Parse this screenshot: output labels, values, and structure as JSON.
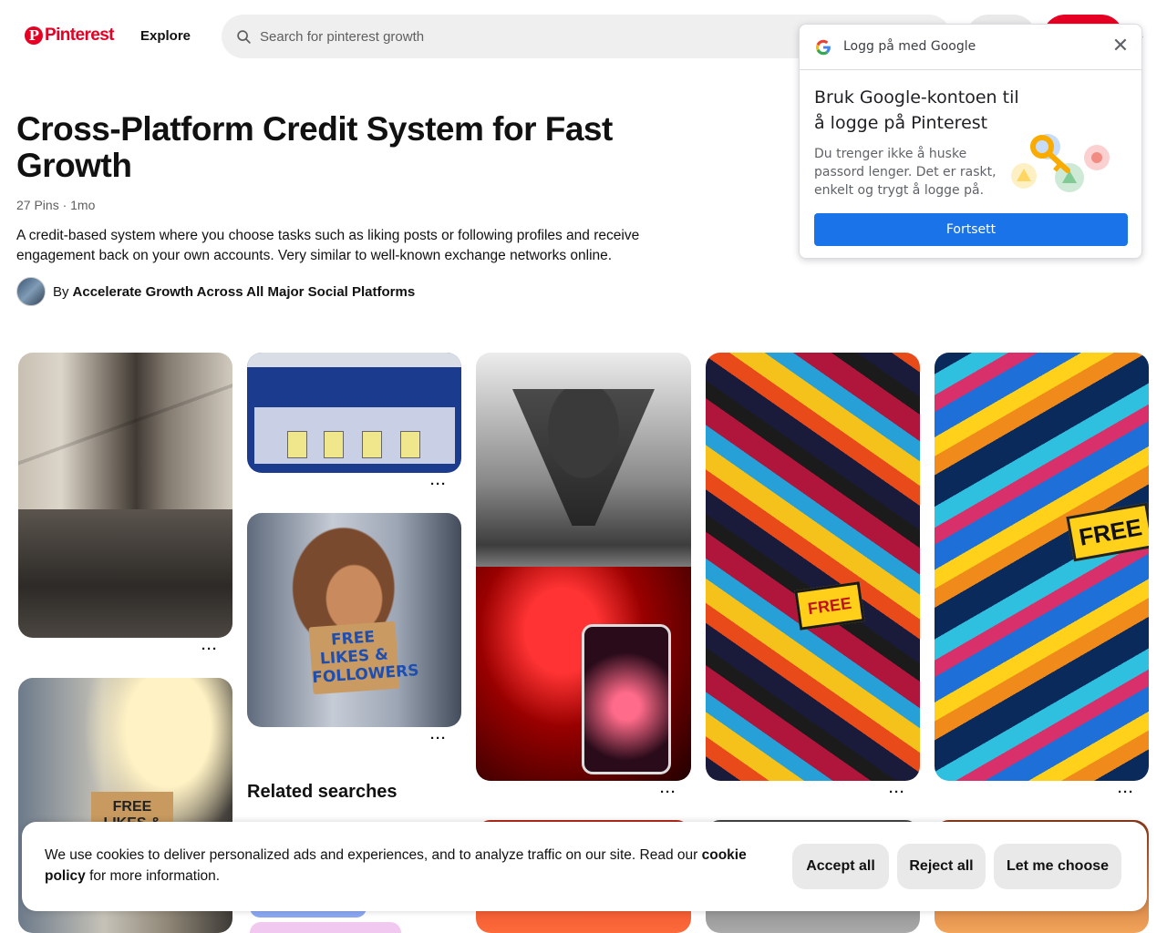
{
  "header": {
    "logo_text": "Pinterest",
    "logo_mark": "P",
    "explore_label": "Explore",
    "search_placeholder": "Search for pinterest growth",
    "icons": {
      "search": "search-icon",
      "chevron": "chevron-down-icon"
    },
    "chevron_glyph": "⌄"
  },
  "board": {
    "title": "Cross-Platform Credit System for Fast Growth",
    "meta": "27 Pins · 1mo",
    "description": "A credit-based system where you choose tasks such as liking posts or following profiles and receive engagement back on your own accounts. Very similar to well-known exchange networks online.",
    "author_prefix": "By",
    "author_name": "Accelerate Growth Across All Major Social Platforms"
  },
  "pins": {
    "more_label": "···",
    "p3_sign": "FREE LIKES & FOLLOWERS",
    "p5_badge": "FREE",
    "p6_badge": "FREE",
    "p7_sign": "FREE LIKES &"
  },
  "related_searches_label": "Related searches",
  "google_popup": {
    "header_text": "Logg på med Google",
    "close_glyph": "✕",
    "title": "Bruk Google-kontoen til å logge på Pinterest",
    "description": "Du trenger ikke å huske passord lenger. Det er raskt, enkelt og trygt å logge på.",
    "continue_label": "Fortsett",
    "colors": {
      "button": "#1a73e8"
    }
  },
  "cookie_banner": {
    "text_before": "We use cookies to deliver personalized ads and experiences, and to analyze traffic on our site. Read our ",
    "link_text": "cookie policy",
    "text_after": " for more information.",
    "accept_label": "Accept all",
    "reject_label": "Reject all",
    "choose_label": "Let me choose"
  },
  "colors": {
    "brand": "#e60023",
    "search_bg": "#efefef",
    "button_bg": "#e9e9e9"
  }
}
